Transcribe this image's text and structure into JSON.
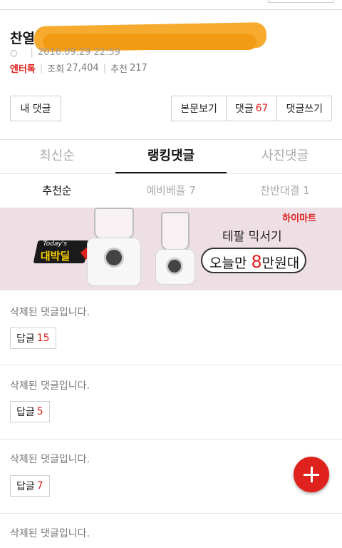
{
  "post": {
    "title": "찬열",
    "author_icon": "○",
    "datetime": "2016.09.29 22:59",
    "category": "엔터톡",
    "views_label": "조회",
    "views": "27,404",
    "recommend_label": "추천",
    "recommend": "217"
  },
  "actions": {
    "my_comments": "내 댓글",
    "view_post": "본문보기",
    "comments_label": "댓글",
    "comments_count": "67",
    "write_comment": "댓글쓰기"
  },
  "tabs": [
    {
      "label": "최신순",
      "active": false
    },
    {
      "label": "랭킹댓글",
      "active": true
    },
    {
      "label": "사진댓글",
      "active": false
    }
  ],
  "subtabs": [
    {
      "label": "추천순",
      "active": true
    },
    {
      "label": "예비베플 7",
      "active": false
    },
    {
      "label": "찬반대결 1",
      "active": false
    }
  ],
  "ad": {
    "brand": "하이마트",
    "badge_top": "Today's",
    "badge_main": "대박딜",
    "line1": "테팔 믹서기",
    "line2_pre": "오늘만 ",
    "line2_num": "8",
    "line2_post": "만원대"
  },
  "comments": [
    {
      "text": "삭제된 댓글입니다.",
      "reply_label": "답글",
      "reply_count": "15"
    },
    {
      "text": "삭제된 댓글입니다.",
      "reply_label": "답글",
      "reply_count": "5"
    },
    {
      "text": "삭제된 댓글입니다.",
      "reply_label": "답글",
      "reply_count": "7"
    },
    {
      "text": "삭제된 댓글입니다.",
      "reply_label": "",
      "reply_count": ""
    }
  ],
  "colors": {
    "accent": "#e0221e",
    "ad_bg": "#eedfe5"
  },
  "icons": {
    "fab": "plus-icon"
  }
}
